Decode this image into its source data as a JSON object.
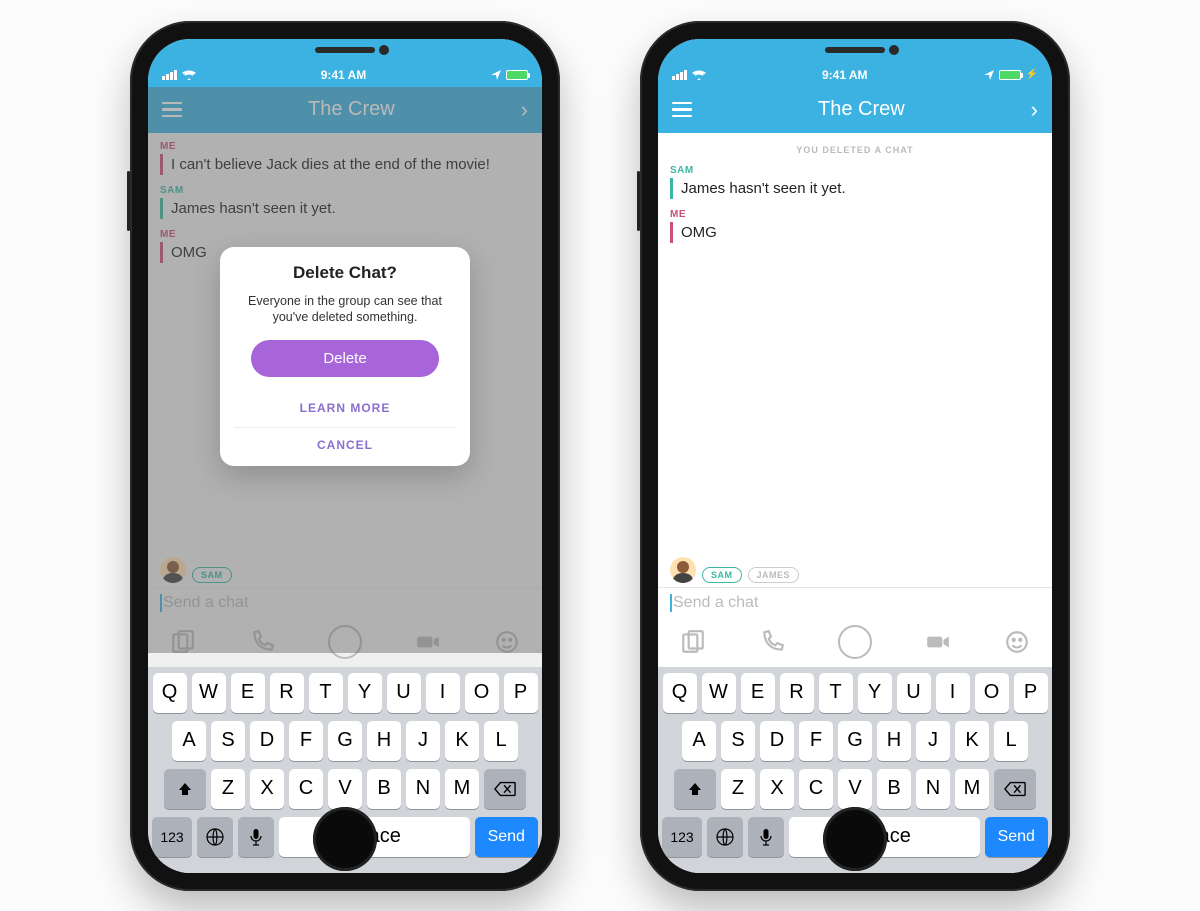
{
  "status": {
    "time": "9:41 AM"
  },
  "header": {
    "title": "The Crew"
  },
  "phone1": {
    "messages": [
      {
        "sender": "ME",
        "class": "me",
        "text": "I can't believe Jack dies at the end of the movie!"
      },
      {
        "sender": "SAM",
        "class": "sam",
        "text": "James hasn't seen it yet."
      },
      {
        "sender": "ME",
        "class": "me",
        "text": "OMG"
      }
    ],
    "presence": [
      {
        "label": "SAM",
        "class": "sam"
      }
    ],
    "input_placeholder": "Send a chat",
    "modal": {
      "title": "Delete Chat?",
      "body": "Everyone in the group can see that you've deleted something.",
      "delete": "Delete",
      "learn": "LEARN MORE",
      "cancel": "CANCEL"
    }
  },
  "phone2": {
    "banner": "YOU DELETED A CHAT",
    "messages": [
      {
        "sender": "SAM",
        "class": "sam",
        "text": "James hasn't seen it yet."
      },
      {
        "sender": "ME",
        "class": "me",
        "text": "OMG"
      }
    ],
    "presence": [
      {
        "label": "SAM",
        "class": "sam"
      },
      {
        "label": "JAMES",
        "class": "james"
      }
    ],
    "input_placeholder": "Send a chat"
  },
  "keyboard": {
    "row1": [
      "Q",
      "W",
      "E",
      "R",
      "T",
      "Y",
      "U",
      "I",
      "O",
      "P"
    ],
    "row2": [
      "A",
      "S",
      "D",
      "F",
      "G",
      "H",
      "J",
      "K",
      "L"
    ],
    "row3": [
      "Z",
      "X",
      "C",
      "V",
      "B",
      "N",
      "M"
    ],
    "n123": "123",
    "space": "space",
    "send": "Send"
  }
}
